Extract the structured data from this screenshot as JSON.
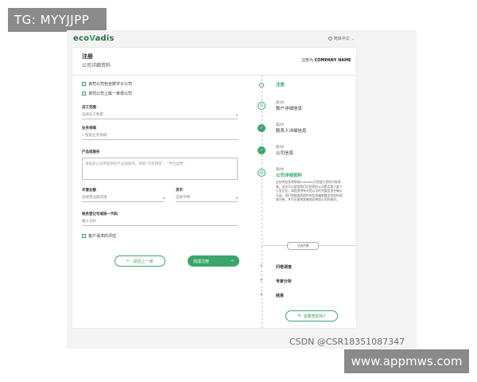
{
  "overlay_tag": "TG: MYYJJPP",
  "app": {
    "logo_prefix": "eco",
    "logo_v": "V",
    "logo_suffix": "adis",
    "language": "简体中文"
  },
  "header": {
    "title": "注册",
    "subtitle": "公司详细资料",
    "registered_as_label": "注册为",
    "company_name": "COMPANY NAME"
  },
  "form": {
    "checkbox_1": "该司公司包含数字子公司",
    "checkbox_2": "该司公司上属一家母公司",
    "employee_range_label": "员工范围",
    "employee_range_value": "选择员工数量",
    "industry_label": "业务领域",
    "industry_placeholder": "搜索业务领域",
    "products_label": "产品或服务",
    "products_placeholder": "请描述公司所提供的产品或服务。例如\"汽车制造\"、\"平台运营\"",
    "revenue_label": "年营业额",
    "revenue_value": "选择营业额范围",
    "currency_label": "货币",
    "currency_value": "选择币种",
    "tax_id_label": "税务登记号或统一代码",
    "tax_id_placeholder": "输入号码",
    "client_review_label": "客户请求的评估",
    "back_button": "返回上一级",
    "done_button": "完成注册"
  },
  "steps": {
    "register_label": "注册",
    "items": [
      {
        "small": "第1步",
        "name": "账户详细信息"
      },
      {
        "small": "第2步",
        "name": "联系人详细信息"
      },
      {
        "small": "第3步",
        "name": "公司信息"
      },
      {
        "small": "第4步",
        "name": "公司详细资料"
      }
    ],
    "description": "此处的信息将帮助EcoVadis为您建立您的问卷调查。这还可以帮助我们识别您的公司是否属于某个小型企业。请您提供有关您公司的完整信息并确认无误。我们将根据您提供的信息编制最适合您的调查问卷，并尽可能地准确地反映您公司的情况。",
    "optional_label": "可选步骤",
    "optional_items": [
      "问卷调查",
      "专家分析",
      "结果"
    ],
    "help_button": "需要帮助吗?"
  },
  "watermarks": {
    "csdn": "CSDN @CSR18351087347",
    "site": "www.appmws.com"
  },
  "colors": {
    "accent": "#3aa66b",
    "logo": "#2c6e3f",
    "overlay": "#8a8a8a"
  }
}
